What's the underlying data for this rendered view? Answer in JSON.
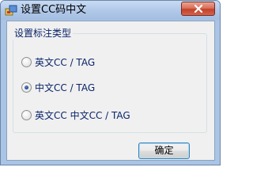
{
  "window": {
    "title": "设置CC码中文"
  },
  "group": {
    "title": "设置标注类型",
    "options": [
      {
        "label": "英文CC / TAG",
        "selected": false
      },
      {
        "label": "中文CC / TAG",
        "selected": true
      },
      {
        "label": "英文CC 中文CC / TAG",
        "selected": false
      }
    ]
  },
  "buttons": {
    "ok_label": "确定"
  },
  "icons": {
    "app": "app-icon",
    "close": "close-icon"
  },
  "colors": {
    "titlebar": "#b3cbea",
    "close_button": "#c4402a",
    "label_text": "#0a246a",
    "dialog_bg": "#f0f0f0"
  }
}
